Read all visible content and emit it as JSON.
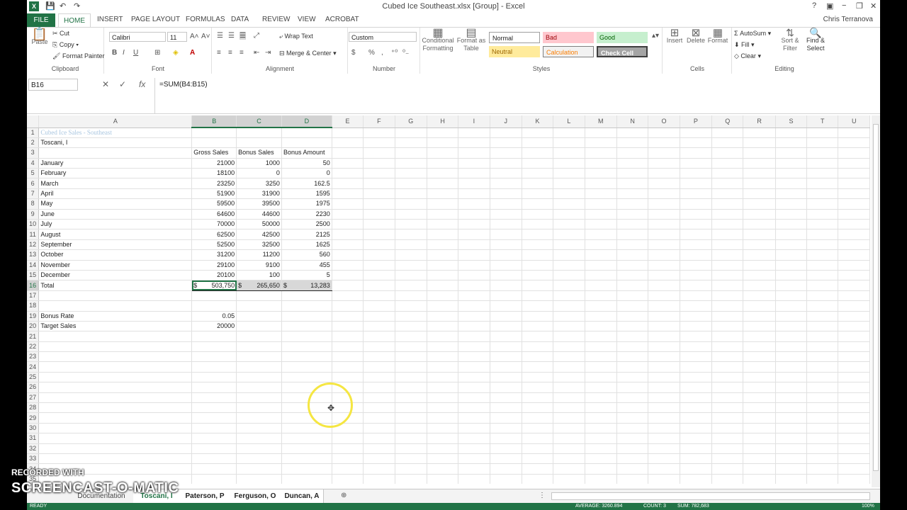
{
  "window": {
    "title": "Cubed Ice Southeast.xlsx  [Group] - Excel",
    "user": "Chris Terranova"
  },
  "qat": {
    "save": "💾",
    "undo": "↶",
    "redo": "↷"
  },
  "tabs": [
    "FILE",
    "HOME",
    "INSERT",
    "PAGE LAYOUT",
    "FORMULAS",
    "DATA",
    "REVIEW",
    "VIEW",
    "ACROBAT"
  ],
  "ribbon": {
    "clipboard": {
      "label": "Clipboard",
      "paste": "Paste",
      "cut": "Cut",
      "copy": "Copy",
      "format_painter": "Format Painter"
    },
    "font": {
      "label": "Font",
      "name": "Calibri",
      "size": "11",
      "bold": "B",
      "italic": "I",
      "underline": "U"
    },
    "alignment": {
      "label": "Alignment",
      "wrap": "Wrap Text",
      "merge": "Merge & Center"
    },
    "number": {
      "label": "Number",
      "format": "Custom",
      "dollar": "$",
      "percent": "%",
      "comma": ","
    },
    "styles": {
      "label": "Styles",
      "conditional": "Conditional Formatting",
      "format_table": "Format as Table",
      "normal": "Normal",
      "bad": "Bad",
      "good": "Good",
      "neutral": "Neutral",
      "calculation": "Calculation",
      "check": "Check Cell"
    },
    "cells": {
      "label": "Cells",
      "insert": "Insert",
      "delete": "Delete",
      "format": "Format"
    },
    "editing": {
      "label": "Editing",
      "autosum": "AutoSum",
      "fill": "Fill",
      "clear": "Clear",
      "sort": "Sort & Filter",
      "find": "Find & Select"
    }
  },
  "formula_bar": {
    "name_box": "B16",
    "formula": "=SUM(B4:B15)",
    "fx": "fx"
  },
  "columns": [
    "A",
    "B",
    "C",
    "D",
    "E",
    "F",
    "G",
    "H",
    "I",
    "J",
    "K",
    "L",
    "M",
    "N",
    "O",
    "P",
    "Q",
    "R",
    "S",
    "T",
    "U"
  ],
  "sheet": {
    "title": "Cubed Ice Sales - Southeast",
    "name": "Toscani, I",
    "headers": [
      "Gross Sales",
      "Bonus Sales",
      "Bonus Amount"
    ],
    "months": [
      {
        "m": "January",
        "g": "21000",
        "s": "1000",
        "b": "50"
      },
      {
        "m": "February",
        "g": "18100",
        "s": "0",
        "b": "0"
      },
      {
        "m": "March",
        "g": "23250",
        "s": "3250",
        "b": "162.5"
      },
      {
        "m": "April",
        "g": "51900",
        "s": "31900",
        "b": "1595"
      },
      {
        "m": "May",
        "g": "59500",
        "s": "39500",
        "b": "1975"
      },
      {
        "m": "June",
        "g": "64600",
        "s": "44600",
        "b": "2230"
      },
      {
        "m": "July",
        "g": "70000",
        "s": "50000",
        "b": "2500"
      },
      {
        "m": "August",
        "g": "62500",
        "s": "42500",
        "b": "2125"
      },
      {
        "m": "September",
        "g": "52500",
        "s": "32500",
        "b": "1625"
      },
      {
        "m": "October",
        "g": "31200",
        "s": "11200",
        "b": "560"
      },
      {
        "m": "November",
        "g": "29100",
        "s": "9100",
        "b": "455"
      },
      {
        "m": "December",
        "g": "20100",
        "s": "100",
        "b": "5"
      }
    ],
    "total": {
      "label": "Total",
      "cur": "$",
      "g": "503,750",
      "s": "265,650",
      "b": "13,283"
    },
    "bonus_rate": {
      "label": "Bonus Rate",
      "value": "0.05"
    },
    "target_sales": {
      "label": "Target Sales",
      "value": "20000"
    }
  },
  "sheet_tabs": [
    "Documentation",
    "Toscani, I",
    "Paterson, P",
    "Ferguson, O",
    "Duncan, A"
  ],
  "status": {
    "ready": "READY",
    "average": "AVERAGE: 3260.894",
    "count": "COUNT: 3",
    "sum": "SUM: 782,683",
    "zoom": "100%"
  },
  "watermark": {
    "line1": "RECORDED WITH",
    "line2": "SCREENCAST-O-MATIC"
  },
  "colors": {
    "excel_green": "#217346",
    "title_blue": "#a9c6e0"
  }
}
